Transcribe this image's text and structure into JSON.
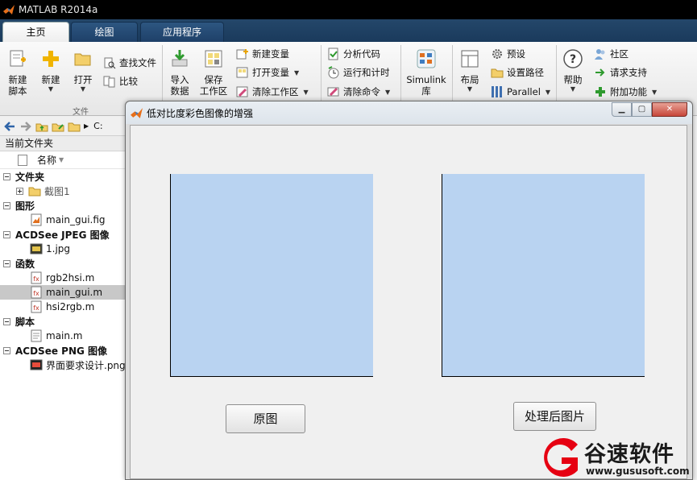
{
  "window": {
    "title": "MATLAB R2014a"
  },
  "tabs": [
    {
      "label": "主页",
      "active": true
    },
    {
      "label": "绘图",
      "active": false
    },
    {
      "label": "应用程序",
      "active": false
    }
  ],
  "ribbon": {
    "new_script": "新建\n脚本",
    "new": "新建",
    "open": "打开",
    "find_files": "查找文件",
    "compare": "比较",
    "group_file": "文件",
    "import_data": "导入\n数据",
    "save_workspace": "保存\n工作区",
    "new_variable": "新建变量",
    "open_variable": "打开变量",
    "clear_workspace": "清除工作区",
    "analyze_code": "分析代码",
    "run_and_time": "运行和计时",
    "clear_commands": "清除命令",
    "simulink": "Simulink\n库",
    "layout": "布局",
    "preferences": "预设",
    "set_path": "设置路径",
    "parallel": "Parallel",
    "help": "帮助",
    "community": "社区",
    "request_support": "请求支持",
    "add_ons": "附加功能"
  },
  "address": {
    "path": "C:"
  },
  "file_panel": {
    "title": "当前文件夹",
    "column_name": "名称",
    "sections": [
      {
        "label": "文件夹",
        "items": [
          {
            "name": "截图1",
            "kind": "folder"
          }
        ]
      },
      {
        "label": "图形",
        "items": [
          {
            "name": "main_gui.fig",
            "kind": "fig"
          }
        ]
      },
      {
        "label": "ACDSee JPEG 图像",
        "items": [
          {
            "name": "1.jpg",
            "kind": "jpg"
          }
        ]
      },
      {
        "label": "函数",
        "items": [
          {
            "name": "rgb2hsi.m",
            "kind": "m"
          },
          {
            "name": "main_gui.m",
            "kind": "m",
            "selected": true
          },
          {
            "name": "hsi2rgb.m",
            "kind": "m"
          }
        ]
      },
      {
        "label": "脚本",
        "items": [
          {
            "name": "main.m",
            "kind": "m"
          }
        ]
      },
      {
        "label": "ACDSee PNG 图像",
        "items": [
          {
            "name": "界面要求设计.png",
            "kind": "png"
          }
        ]
      }
    ]
  },
  "figure": {
    "title": "低对比度彩色图像的增强",
    "btn_original": "原图",
    "btn_processed": "处理后图片",
    "axes_color": "#b9d3f1"
  },
  "watermark": {
    "name": "谷速软件",
    "url": "www.gususoft.com",
    "color": "#e60012"
  }
}
